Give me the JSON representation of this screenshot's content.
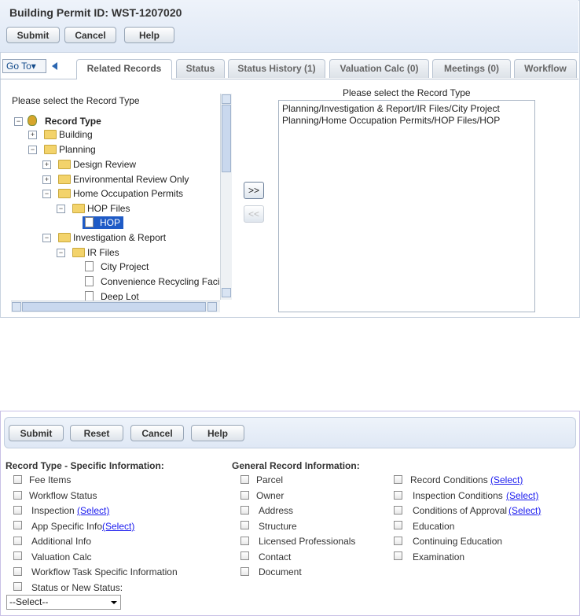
{
  "permit": {
    "title": "Building Permit ID: WST-1207020",
    "buttons": [
      "Submit",
      "Cancel",
      "Help"
    ],
    "goto_label": "Go To▾",
    "tabs": [
      "Related Records",
      "Status",
      "Status History (1)",
      "Valuation Calc (0)",
      "Meetings (0)",
      "Workflow"
    ],
    "tree_heading": "Please select the Record Type",
    "tree": [
      {
        "label": "Record Type",
        "level": 0,
        "expanded": true,
        "type": "root"
      },
      {
        "label": "Building",
        "level": 1,
        "expanded": false,
        "type": "folder"
      },
      {
        "label": "Planning",
        "level": 1,
        "expanded": true,
        "type": "folder"
      },
      {
        "label": "Design Review",
        "level": 2,
        "expanded": false,
        "type": "folder"
      },
      {
        "label": "Environmental Review Only",
        "level": 2,
        "expanded": false,
        "type": "folder"
      },
      {
        "label": "Home Occupation Permits",
        "level": 2,
        "expanded": true,
        "type": "folder"
      },
      {
        "label": "HOP Files",
        "level": 3,
        "expanded": true,
        "type": "folder"
      },
      {
        "label": "HOP",
        "level": 4,
        "type": "doc",
        "selected": true
      },
      {
        "label": "Investigation & Report",
        "level": 2,
        "expanded": true,
        "type": "folder"
      },
      {
        "label": "IR Files",
        "level": 3,
        "expanded": true,
        "type": "folder"
      },
      {
        "label": "City Project",
        "level": 4,
        "type": "doc"
      },
      {
        "label": "Convenience Recycling Faci",
        "level": 4,
        "type": "doc"
      },
      {
        "label": "Deep Lot",
        "level": 4,
        "type": "doc"
      }
    ],
    "add_button": ">>",
    "remove_button": "<<",
    "list_heading": "Please select the Record Type",
    "selected_records": [
      "Planning/Investigation & Report/IR Files/City Project",
      "Planning/Home Occupation Permits/HOP Files/HOP"
    ]
  },
  "options": {
    "buttons": [
      "Submit",
      "Reset",
      "Cancel",
      "Help"
    ],
    "specific_heading": "Record Type - Specific Information:",
    "general_heading": "General Record Information:",
    "specific": [
      {
        "label": "Fee Items",
        "link": ""
      },
      {
        "label": "Workflow Status",
        "link": ""
      },
      {
        "label": "Inspection",
        "link": "(Select)"
      },
      {
        "label": "App Specific Info",
        "link": "(Select)"
      },
      {
        "label": "Additional Info",
        "link": ""
      },
      {
        "label": "Valuation Calc",
        "link": ""
      },
      {
        "label": "Workflow Task Specific Information",
        "link": ""
      },
      {
        "label": "Status or New Status:",
        "link": ""
      }
    ],
    "general_col1": [
      "Parcel",
      "Owner",
      "Address",
      "Structure",
      "Licensed Professionals",
      "Contact",
      "Document"
    ],
    "general_col2": [
      {
        "label": "Record Conditions",
        "link": "(Select)"
      },
      {
        "label": "Inspection Conditions",
        "link": "(Select)"
      },
      {
        "label": "Conditions of Approval",
        "link": "(Select)"
      },
      {
        "label": "Education",
        "link": ""
      },
      {
        "label": "Continuing Education",
        "link": ""
      },
      {
        "label": "Examination",
        "link": ""
      }
    ],
    "status_select": "--Select--"
  }
}
